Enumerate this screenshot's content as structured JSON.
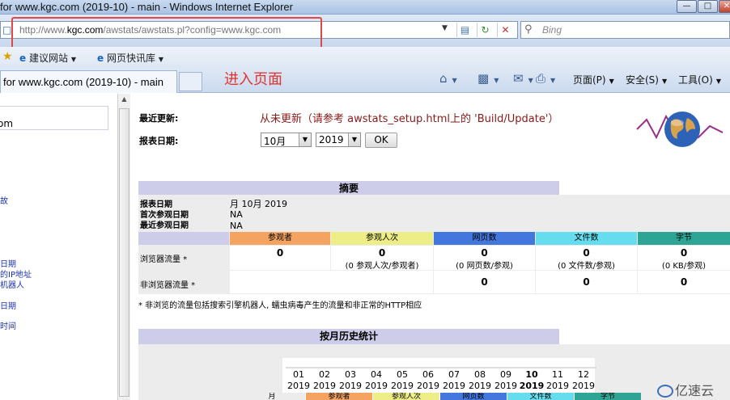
{
  "window": {
    "title": "for www.kgc.com (2019-10) - main - Windows Internet Explorer"
  },
  "address_bar": {
    "url_prefix": "http://www.",
    "url_host": "kgc.com",
    "url_suffix": "/awstats/awstats.pl?config=www.kgc.com"
  },
  "search": {
    "placeholder": "Bing"
  },
  "favorites": {
    "items": [
      "建议网站",
      "网页快讯库"
    ]
  },
  "annotation": "进入页面",
  "tab": {
    "label": "for www.kgc.com (2019-10) - main"
  },
  "command_bar": {
    "page": "页面(P)",
    "safety": "安全(S)",
    "tools": "工具(O)"
  },
  "left_frame": {
    "host_fragment": "om",
    "links": [
      "故",
      "日期",
      "的IP地址",
      "机器人",
      "日期",
      "时间"
    ]
  },
  "report": {
    "last_update_label": "最近更新:",
    "last_update_value": "从未更新（请参考 awstats_setup.html上的 'Build/Update'）",
    "report_date_label": "报表日期:",
    "month": "10月",
    "year": "2019",
    "ok": "OK"
  },
  "summary": {
    "title": "摘要",
    "rows": [
      {
        "label": "报表日期",
        "value": "月 10月 2019"
      },
      {
        "label": "首次参观日期",
        "value": "NA"
      },
      {
        "label": "最近参观日期",
        "value": "NA"
      }
    ],
    "columns": [
      "参观者",
      "参观人次",
      "网页数",
      "文件数",
      "字节"
    ],
    "column_colors": [
      "#f4a460",
      "#eeee88",
      "#4477dd",
      "#66ddee",
      "#2ea495"
    ],
    "browser_label": "浏览器流量 *",
    "browser_values": [
      "0",
      "0",
      "0",
      "0",
      "0"
    ],
    "browser_sub": [
      "",
      "(0 参观人次/参观者)",
      "(0 网页数/参观)",
      "(0 文件数/参观)",
      "(0 KB/参观)"
    ],
    "nonbrowser_label": "非浏览器流量 *",
    "nonbrowser_values": [
      "0",
      "0",
      "0"
    ],
    "footnote": "* 非浏览的流量包括搜索引擎机器人, 蠕虫病毒产生的流量和非正常的HTTP相应"
  },
  "history": {
    "title": "按月历史统计",
    "months": [
      "01",
      "02",
      "03",
      "04",
      "05",
      "06",
      "07",
      "08",
      "09",
      "10",
      "11",
      "12"
    ],
    "year": "2019",
    "current_month_index": 9,
    "columns": [
      "月",
      "参观者",
      "参观人次",
      "网页数",
      "文件数",
      "字节"
    ]
  },
  "watermark": "亿速云"
}
